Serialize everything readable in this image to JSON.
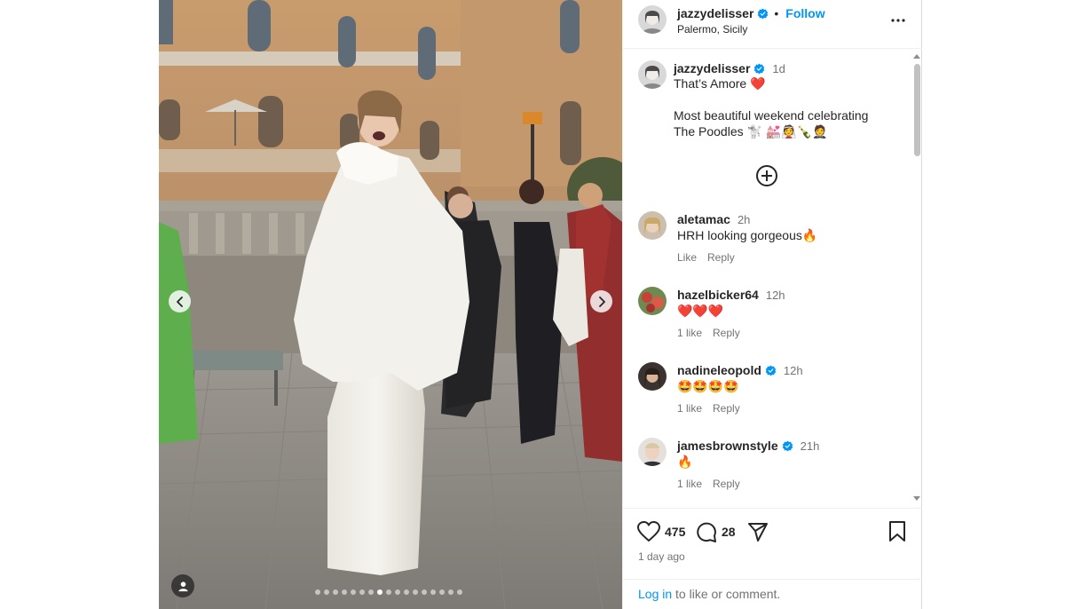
{
  "post": {
    "username": "jazzydelisser",
    "follow_label": "Follow",
    "location": "Palermo, Sicily",
    "caption_time": "1d",
    "caption_lines": [
      "That’s Amore ❤️",
      "",
      "Most beautiful weekend celebrating",
      "The Poodles 🐩 💒👰🍾🤵"
    ]
  },
  "comments": [
    {
      "username": "aletamac",
      "verified": false,
      "time": "2h",
      "text": "HRH looking gorgeous🔥",
      "likes": "",
      "reply": "Reply",
      "like_label": "Like"
    },
    {
      "username": "hazelbicker64",
      "verified": false,
      "time": "12h",
      "text": "❤️❤️❤️",
      "likes": "1 like",
      "reply": "Reply"
    },
    {
      "username": "nadineleopold",
      "verified": true,
      "time": "12h",
      "text": "🤩🤩🤩🤩",
      "likes": "1 like",
      "reply": "Reply"
    },
    {
      "username": "jamesbrownstyle",
      "verified": true,
      "time": "21h",
      "text": "🔥",
      "likes": "1 like",
      "reply": "Reply"
    }
  ],
  "stats": {
    "likes": "475",
    "comments": "28",
    "posted": "1 day ago"
  },
  "footer": {
    "login_link": "Log in",
    "login_rest": " to like or comment."
  },
  "carousel": {
    "total": 17,
    "active": 8
  },
  "colors": {
    "link_blue": "#0095f6",
    "verified_blue": "#0095f6",
    "text": "#262626",
    "muted": "#737373",
    "heart_red": "#ed4956"
  },
  "icons": [
    "chevron-left-icon",
    "chevron-right-icon",
    "user-tag-icon",
    "verified-badge-icon",
    "more-dots-icon",
    "plus-circle-icon",
    "heart-icon",
    "comment-icon",
    "share-icon",
    "bookmark-icon"
  ]
}
